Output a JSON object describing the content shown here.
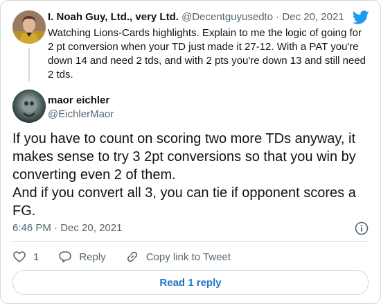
{
  "parent_tweet": {
    "name": "I. Noah Guy, Ltd., very Ltd.",
    "handle": "@Decentguyusedto",
    "separator": "·",
    "date": "Dec 20, 2021",
    "text": "Watching Lions-Cards highlights. Explain to me the logic of going for 2 pt conversion when your TD just made it 27-12. With a PAT you're down 14 and need 2 tds, and with 2 pts you're down 13 and still need 2 tds."
  },
  "reply_tweet": {
    "name": "maor eichler",
    "handle": "@EichlerMaor",
    "paragraphs": [
      "If you have to count on scoring two more TDs anyway, it makes sense to try 3 2pt conversions so that you win by converting even 2 of them.",
      "And if you convert all 3, you can tie if opponent scores a FG."
    ],
    "time": "6:46 PM",
    "separator": "·",
    "date": "Dec 20, 2021"
  },
  "actions": {
    "like_count": "1",
    "reply_label": "Reply",
    "copy_link_label": "Copy link to Tweet"
  },
  "read_replies_label": "Read 1 reply",
  "colors": {
    "twitter_blue": "#1d9bf0",
    "link_blue": "#1d73c9",
    "muted": "#536471",
    "border": "#cfd9de"
  }
}
